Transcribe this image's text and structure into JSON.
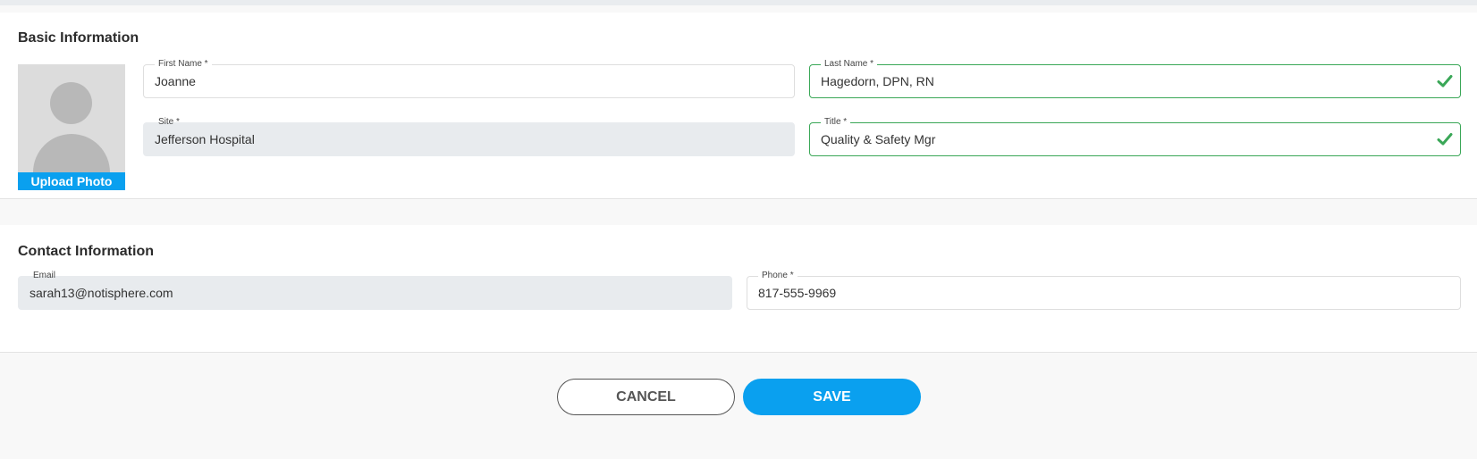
{
  "basic": {
    "title": "Basic Information",
    "upload_label": "Upload Photo",
    "first_name": {
      "label": "First Name *",
      "value": "Joanne"
    },
    "last_name": {
      "label": "Last Name *",
      "value": "Hagedorn, DPN, RN"
    },
    "site": {
      "label": "Site *",
      "value": "Jefferson Hospital"
    },
    "job_title": {
      "label": "Title *",
      "value": "Quality & Safety Mgr"
    }
  },
  "contact": {
    "title": "Contact Information",
    "email": {
      "label": "Email",
      "value": "sarah13@notisphere.com"
    },
    "phone": {
      "label": "Phone *",
      "value": "817-555-9969"
    }
  },
  "actions": {
    "cancel_label": "CANCEL",
    "save_label": "SAVE"
  },
  "colors": {
    "accent": "#0aa0ef",
    "valid": "#3aa757",
    "disabled_field": "#e8ebee"
  },
  "icons": {
    "avatar": "user-silhouette-icon",
    "valid": "check-icon"
  }
}
